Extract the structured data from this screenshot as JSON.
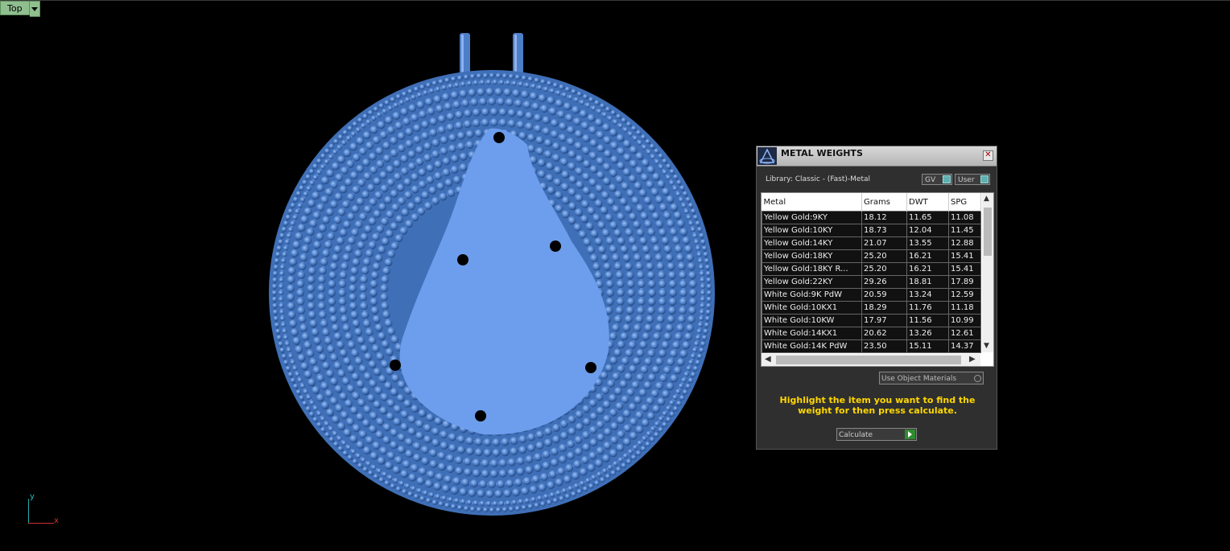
{
  "viewport": {
    "view_label": "Top",
    "axis_y": "y",
    "axis_x": "x"
  },
  "panel": {
    "title": "METAL WEIGHTS",
    "library": "Library: Classic - (Fast)-Metal",
    "toggle_gv": "GV",
    "toggle_user": "User",
    "table": {
      "headers": [
        "Metal",
        "Grams",
        "DWT",
        "SPG"
      ],
      "rows": [
        [
          "Yellow Gold:9KY",
          "18.12",
          "11.65",
          "11.08"
        ],
        [
          "Yellow Gold:10KY",
          "18.73",
          "12.04",
          "11.45"
        ],
        [
          "Yellow Gold:14KY",
          "21.07",
          "13.55",
          "12.88"
        ],
        [
          "Yellow Gold:18KY",
          "25.20",
          "16.21",
          "15.41"
        ],
        [
          "Yellow Gold:18KY R...",
          "25.20",
          "16.21",
          "15.41"
        ],
        [
          "Yellow Gold:22KY",
          "29.26",
          "18.81",
          "17.89"
        ],
        [
          "White Gold:9K PdW",
          "20.59",
          "13.24",
          "12.59"
        ],
        [
          "White Gold:10KX1",
          "18.29",
          "11.76",
          "11.18"
        ],
        [
          "White Gold:10KW",
          "17.97",
          "11.56",
          "10.99"
        ],
        [
          "White Gold:14KX1",
          "20.62",
          "13.26",
          "12.61"
        ],
        [
          "White Gold:14K PdW",
          "23.50",
          "15.11",
          "14.37"
        ]
      ]
    },
    "use_object_materials": "Use Object Materials",
    "hint": "Highlight the item you want to find the weight for then press calculate.",
    "calculate": "Calculate"
  }
}
